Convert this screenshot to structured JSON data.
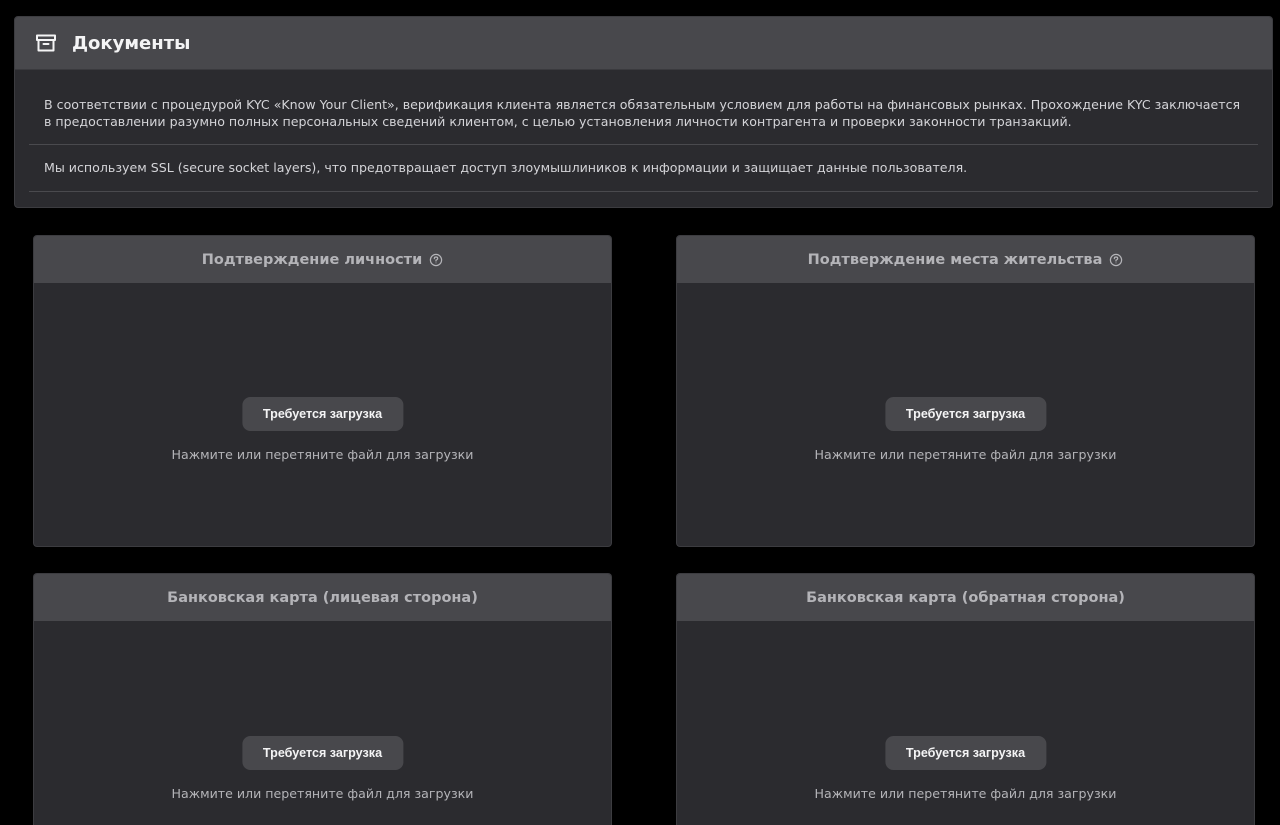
{
  "documents": {
    "title": "Документы",
    "icon": "archive-box-icon",
    "paragraphs": [
      "В соответствии с процедурой KYC «Know Your Client», верификация клиента является обязательным условием для работы на финансовых рынках. Прохождение KYC заключается в предоставлении разумно полных персональных сведений клиентом, с целью установления личности контрагента и проверки законности транзакций.",
      "Мы используем SSL (secure socket layers), что предотвращает доступ злоумышлиников к информации и защищает данные пользователя."
    ]
  },
  "cards": [
    {
      "title": "Подтверждение личности",
      "has_help": true,
      "button": "Требуется загрузка",
      "hint": "Нажмите или перетяните файл для загрузки"
    },
    {
      "title": "Подтверждение места жительства",
      "has_help": true,
      "button": "Требуется загрузка",
      "hint": "Нажмите или перетяните файл для загрузки"
    },
    {
      "title": "Банковская карта (лицевая сторона)",
      "has_help": false,
      "button": "Требуется загрузка",
      "hint": "Нажмите или перетяните файл для загрузки"
    },
    {
      "title": "Банковская карта (обратная сторона)",
      "has_help": false,
      "button": "Требуется загрузка",
      "hint": "Нажмите или перетяните файл для загрузки"
    }
  ],
  "colors": {
    "background": "#000000",
    "panel": "#2b2b2f",
    "header": "#48484c",
    "button": "#48484c",
    "muted_text": "#b4b4b8"
  }
}
